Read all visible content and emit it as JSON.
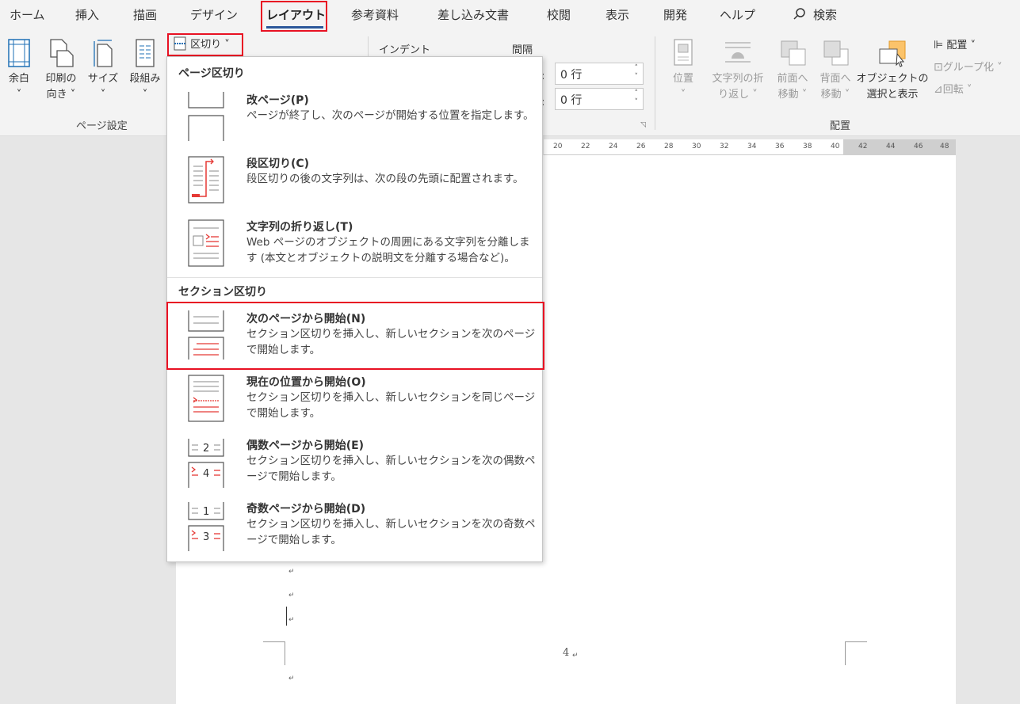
{
  "tabs": [
    {
      "label": "ホーム"
    },
    {
      "label": "挿入"
    },
    {
      "label": "描画"
    },
    {
      "label": "デザイン"
    },
    {
      "label": "レイアウト"
    },
    {
      "label": "参考資料"
    },
    {
      "label": "差し込み文書"
    },
    {
      "label": "校閲"
    },
    {
      "label": "表示"
    },
    {
      "label": "開発"
    },
    {
      "label": "ヘルプ"
    },
    {
      "label": "検索"
    }
  ],
  "ribbon": {
    "page_setup": {
      "margins": "余白",
      "orientation_1": "印刷の",
      "orientation_2": "向き ˅",
      "size": "サイズ",
      "columns": "段組み",
      "breaks": "区切り ˅",
      "group_label": "ページ設定"
    },
    "paragraph": {
      "indent": "インデント",
      "spacing": "間隔",
      "before_prefix": "前:",
      "after_prefix": "後:",
      "before_value": "0 行",
      "after_value": "0 行"
    },
    "arrange": {
      "position": "位置",
      "wrap_1": "文字列の折",
      "wrap_2": "り返し ˅",
      "forward_1": "前面へ",
      "forward_2": "移動 ˅",
      "backward_1": "背面へ",
      "backward_2": "移動 ˅",
      "selection_1": "オブジェクトの",
      "selection_2": "選択と表示",
      "align": "配置 ˅",
      "group": "グループ化 ˅",
      "rotate": "回転 ˅",
      "group_label": "配置"
    }
  },
  "ruler": [
    "20",
    "22",
    "24",
    "26",
    "28",
    "30",
    "32",
    "34",
    "36",
    "38",
    "40",
    "42",
    "44",
    "46",
    "48"
  ],
  "menu": {
    "page_breaks_header": "ページ区切り",
    "section_breaks_header": "セクション区切り",
    "items": [
      {
        "title": "改ページ(P)",
        "desc": "ページが終了し、次のページが開始する位置を指定します。"
      },
      {
        "title": "段区切り(C)",
        "desc": "段区切りの後の文字列は、次の段の先頭に配置されます。"
      },
      {
        "title": "文字列の折り返し(T)",
        "desc": "Web ページのオブジェクトの周囲にある文字列を分離します (本文とオブジェクトの説明文を分離する場合など)。"
      },
      {
        "title": "次のページから開始(N)",
        "desc": "セクション区切りを挿入し、新しいセクションを次のページで開始します。"
      },
      {
        "title": "現在の位置から開始(O)",
        "desc": "セクション区切りを挿入し、新しいセクションを同じページで開始します。"
      },
      {
        "title": "偶数ページから開始(E)",
        "desc": "セクション区切りを挿入し、新しいセクションを次の偶数ページで開始します。"
      },
      {
        "title": "奇数ページから開始(D)",
        "desc": "セクション区切りを挿入し、新しいセクションを次の奇数ページで開始します。"
      }
    ]
  },
  "document": {
    "page_number": "4",
    "para_mark": "↵"
  },
  "colors": {
    "highlight": "#e81123",
    "accent": "#2b579a",
    "icon_red": "#e53935"
  }
}
